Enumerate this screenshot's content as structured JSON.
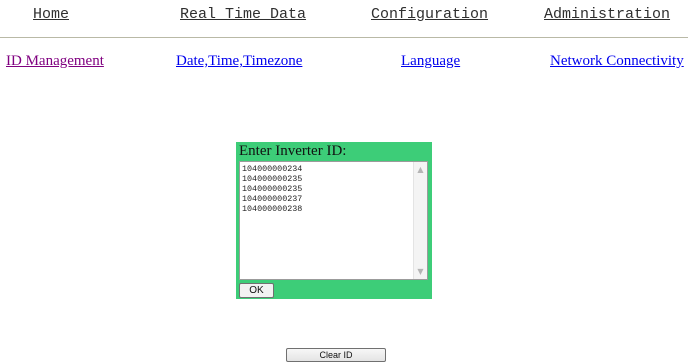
{
  "top_nav": {
    "home": "Home",
    "real_time_data": "Real Time Data",
    "configuration": "Configuration",
    "administration": "Administration"
  },
  "sub_nav": {
    "id_management": "ID Management",
    "date_time": "Date,Time,Timezone",
    "language": "Language",
    "network": "Network Connectivity"
  },
  "id_panel": {
    "title": "Enter Inverter ID:",
    "ids": [
      "104000000234",
      "104000000235",
      "104000000235",
      "104000000237",
      "104000000238"
    ],
    "ok_label": "OK"
  },
  "clear_button": "Clear ID",
  "colors": {
    "panel_bg": "#3dcd78",
    "visited_link": "#800080",
    "link": "#0000ee"
  }
}
